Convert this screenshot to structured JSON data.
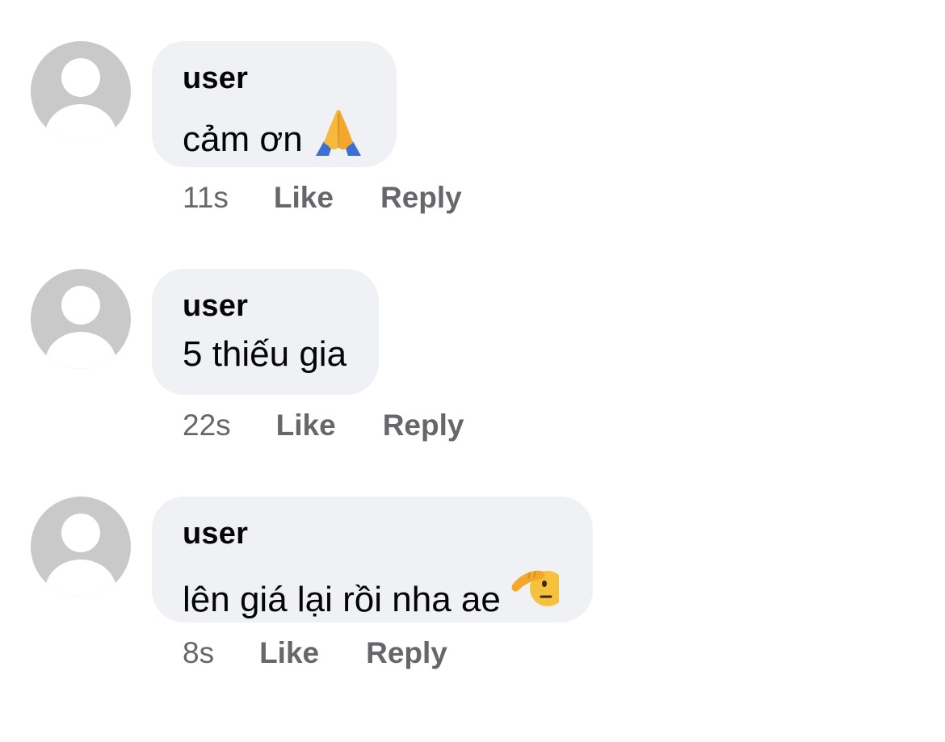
{
  "comments": [
    {
      "author": "user",
      "text": "cảm ơn",
      "emoji_icon": "folded-hands-icon",
      "time": "11s",
      "like_label": "Like",
      "reply_label": "Reply"
    },
    {
      "author": "user",
      "text": "5 thiếu gia",
      "time": "22s",
      "like_label": "Like",
      "reply_label": "Reply"
    },
    {
      "author": "user",
      "text": "lên giá lại rồi nha ae",
      "emoji_icon": "saluting-face-icon",
      "time": "8s",
      "like_label": "Like",
      "reply_label": "Reply"
    }
  ],
  "colors": {
    "bubble_bg": "#f0f1f5",
    "avatar_bg": "#c9c9c9",
    "meta_text": "#65676b",
    "primary_text": "#050505"
  }
}
